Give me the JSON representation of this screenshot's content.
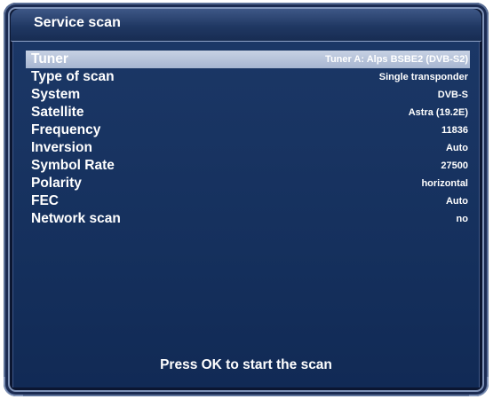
{
  "window": {
    "title": "Service scan"
  },
  "settings": [
    {
      "label": "Tuner",
      "value": "Tuner A: Alps BSBE2 (DVB-S2)",
      "selected": true
    },
    {
      "label": "Type of scan",
      "value": "Single transponder",
      "selected": false
    },
    {
      "label": "System",
      "value": "DVB-S",
      "selected": false
    },
    {
      "label": "Satellite",
      "value": "Astra (19.2E)",
      "selected": false
    },
    {
      "label": "Frequency",
      "value": "11836",
      "selected": false
    },
    {
      "label": "Inversion",
      "value": "Auto",
      "selected": false
    },
    {
      "label": "Symbol Rate",
      "value": "27500",
      "selected": false
    },
    {
      "label": "Polarity",
      "value": "horizontal",
      "selected": false
    },
    {
      "label": "FEC",
      "value": "Auto",
      "selected": false
    },
    {
      "label": "Network scan",
      "value": "no",
      "selected": false
    }
  ],
  "footer": {
    "hint": "Press OK to start the scan"
  },
  "colors": {
    "background": "#15305d",
    "selection": "#b8c4da",
    "text": "#ffffff"
  }
}
